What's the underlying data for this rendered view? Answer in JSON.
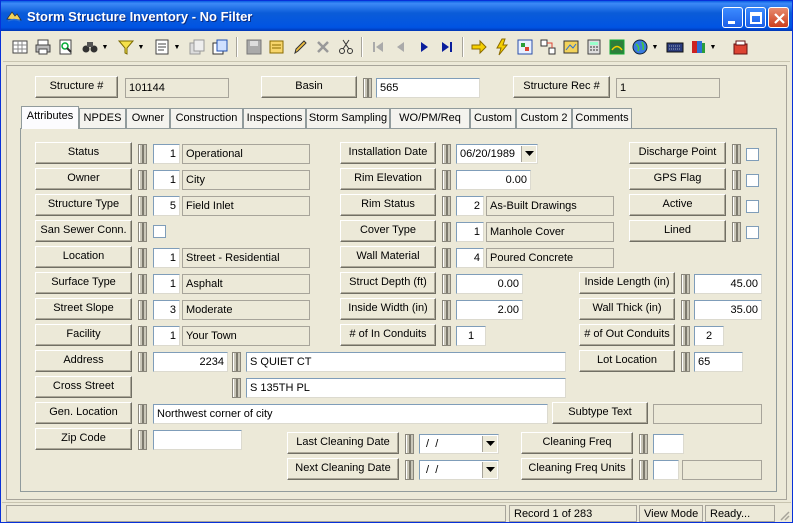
{
  "window": {
    "title": "Storm Structure Inventory - No Filter"
  },
  "titlebar_buttons": [
    "minimize-icon",
    "maximize-icon",
    "close-icon"
  ],
  "toolbar": {
    "icons": [
      "grid-view-icon",
      "print-icon",
      "print-preview-icon",
      "binoculars-icon",
      "filter-icon",
      "report-icon",
      "copy-record-icon",
      "clone-icon",
      "save-icon",
      "edit-records-icon",
      "edit-pencil-icon",
      "delete-icon",
      "cut-icon",
      "first-record-icon",
      "previous-record-icon",
      "next-record-icon",
      "last-record-icon",
      "arrow-jump-icon",
      "lightning-icon",
      "attach-icon",
      "links-icon",
      "map-icon",
      "calculator-icon",
      "gis-map-icon",
      "globe-icon",
      "keyboard-icon",
      "books-icon",
      "exit-icon"
    ]
  },
  "header": {
    "structure_label": "Structure #",
    "structure_value": "101144",
    "basin_label": "Basin",
    "basin_value": "565",
    "rec_label": "Structure Rec #",
    "rec_value": "1"
  },
  "tabs": [
    "Attributes",
    "NPDES",
    "Owner",
    "Construction",
    "Inspections",
    "Storm Sampling",
    "WO/PM/Req",
    "Custom",
    "Custom 2",
    "Comments"
  ],
  "active_tab": "Attributes",
  "left": {
    "status_label": "Status",
    "status_code": "1",
    "status_desc": "Operational",
    "owner_label": "Owner",
    "owner_code": "1",
    "owner_desc": "City",
    "type_label": "Structure Type",
    "type_code": "5",
    "type_desc": "Field Inlet",
    "sewer_label": "San Sewer Conn.",
    "location_label": "Location",
    "location_code": "1",
    "location_desc": "Street - Residential",
    "surface_label": "Surface Type",
    "surface_code": "1",
    "surface_desc": "Asphalt",
    "slope_label": "Street Slope",
    "slope_code": "3",
    "slope_desc": "Moderate",
    "facility_label": "Facility",
    "facility_code": "1",
    "facility_desc": "Your Town",
    "address_label": "Address",
    "address_number": "2234",
    "address_street": "S QUIET CT",
    "cross_label": "Cross Street",
    "cross_value": "S 135TH PL",
    "genloc_label": "Gen. Location",
    "genloc_value": "Northwest corner of city",
    "zip_label": "Zip Code",
    "zip_value": ""
  },
  "middle": {
    "install_label": "Installation Date",
    "install_value": "06/20/1989",
    "rim_elev_label": "Rim Elevation",
    "rim_elev_value": "0.00",
    "rim_status_label": "Rim Status",
    "rim_status_code": "2",
    "rim_status_desc": "As-Built Drawings",
    "cover_label": "Cover Type",
    "cover_code": "1",
    "cover_desc": "Manhole Cover",
    "wall_label": "Wall Material",
    "wall_code": "4",
    "wall_desc": "Poured Concrete",
    "depth_label": "Struct Depth (ft)",
    "depth_value": "0.00",
    "width_label": "Inside Width (in)",
    "width_value": "2.00",
    "inconduits_label": "# of In Conduits",
    "inconduits_value": "1"
  },
  "right": {
    "discharge_label": "Discharge Point",
    "gps_label": "GPS Flag",
    "active_label": "Active",
    "lined_label": "Lined",
    "length_label": "Inside Length (in)",
    "length_value": "45.00",
    "thick_label": "Wall Thick (in)",
    "thick_value": "35.00",
    "outconduits_label": "# of Out Conduits",
    "outconduits_value": "2",
    "lot_label": "Lot Location",
    "lot_value": "65",
    "subtype_label": "Subtype Text",
    "subtype_value": ""
  },
  "cleaning": {
    "last_label": "Last Cleaning Date",
    "last_value": " /  /",
    "next_label": "Next Cleaning Date",
    "next_value": " /  /",
    "freq_label": "Cleaning Freq",
    "freq_value": "",
    "units_label": "Cleaning Freq Units",
    "units_value": ""
  },
  "statusbar": {
    "record": "Record 1 of 283",
    "mode": "View Mode",
    "state": "Ready..."
  }
}
